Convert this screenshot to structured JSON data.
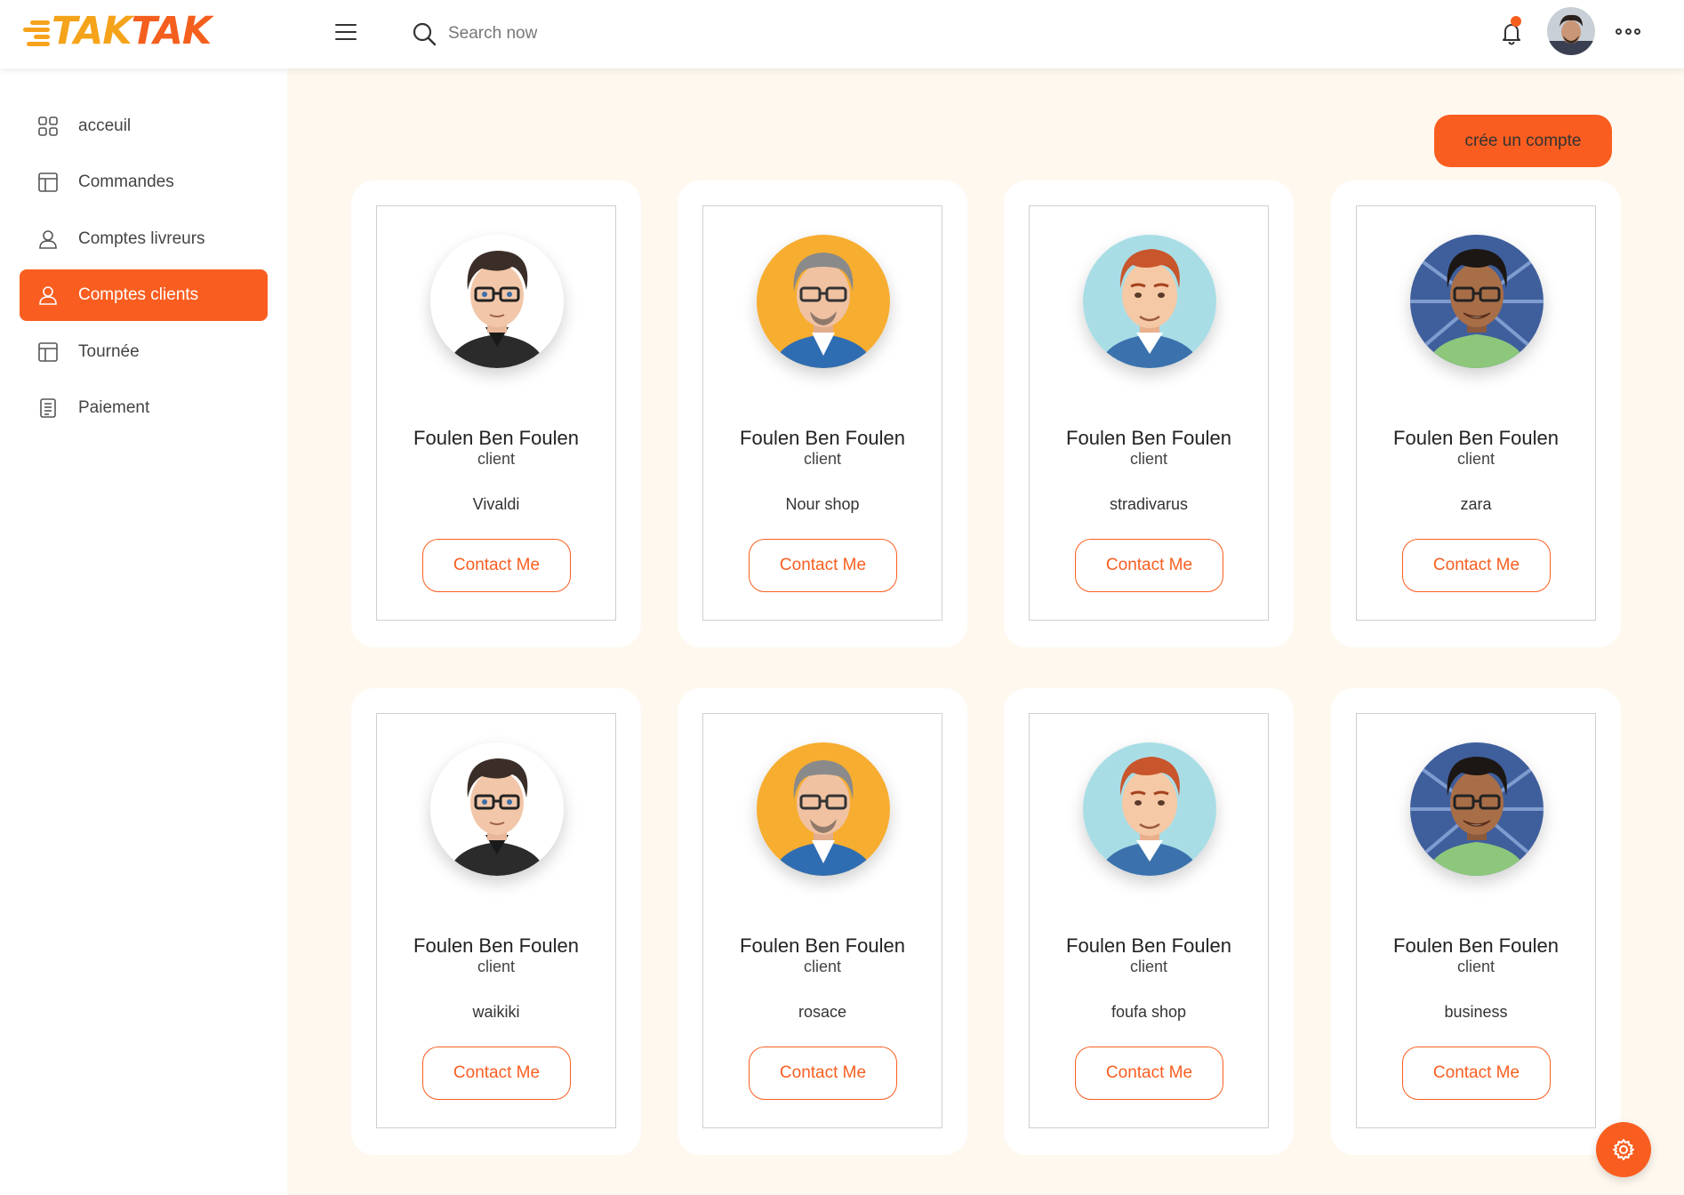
{
  "brand": {
    "logo_part1": "TAK",
    "logo_part2": "TAK"
  },
  "header": {
    "search_placeholder": "Search now",
    "icons": {
      "menu": "hamburger-menu-icon",
      "search": "search-icon",
      "notifications": "bell-icon",
      "more": "more-dots-icon"
    }
  },
  "sidebar": {
    "items": [
      {
        "label": "acceuil",
        "icon": "grid-icon"
      },
      {
        "label": "Commandes",
        "icon": "layout-icon"
      },
      {
        "label": "Comptes livreurs",
        "icon": "user-icon"
      },
      {
        "label": "Comptes clients",
        "icon": "user-icon"
      },
      {
        "label": "Tournée",
        "icon": "layout-icon"
      },
      {
        "label": "Paiement",
        "icon": "document-icon"
      }
    ],
    "active_index": 3
  },
  "main": {
    "create_button": "crée un compte",
    "cards": [
      {
        "name": "Foulen Ben Foulen",
        "role": "client",
        "shop": "Vivaldi",
        "button": "Contact Me",
        "avatar": "avatar-young-man"
      },
      {
        "name": "Foulen Ben Foulen",
        "role": "client",
        "shop": "Nour shop",
        "button": "Contact Me",
        "avatar": "avatar-grey-man"
      },
      {
        "name": "Foulen Ben Foulen",
        "role": "client",
        "shop": "stradivarus",
        "button": "Contact Me",
        "avatar": "avatar-redhead-man"
      },
      {
        "name": "Foulen Ben Foulen",
        "role": "client",
        "shop": "zara",
        "button": "Contact Me",
        "avatar": "avatar-dark-man"
      },
      {
        "name": "Foulen Ben Foulen",
        "role": "client",
        "shop": "waikiki",
        "button": "Contact Me",
        "avatar": "avatar-young-man"
      },
      {
        "name": "Foulen Ben Foulen",
        "role": "client",
        "shop": "rosace",
        "button": "Contact Me",
        "avatar": "avatar-grey-man"
      },
      {
        "name": "Foulen Ben Foulen",
        "role": "client",
        "shop": "foufa shop",
        "button": "Contact Me",
        "avatar": "avatar-redhead-man"
      },
      {
        "name": "Foulen Ben Foulen",
        "role": "client",
        "shop": "business",
        "button": "Contact Me",
        "avatar": "avatar-dark-man"
      }
    ]
  },
  "fab": {
    "icon": "gear-icon"
  },
  "colors": {
    "accent": "#f95e20",
    "logo_orange": "#f5a31a",
    "main_bg": "#fef8ef"
  }
}
